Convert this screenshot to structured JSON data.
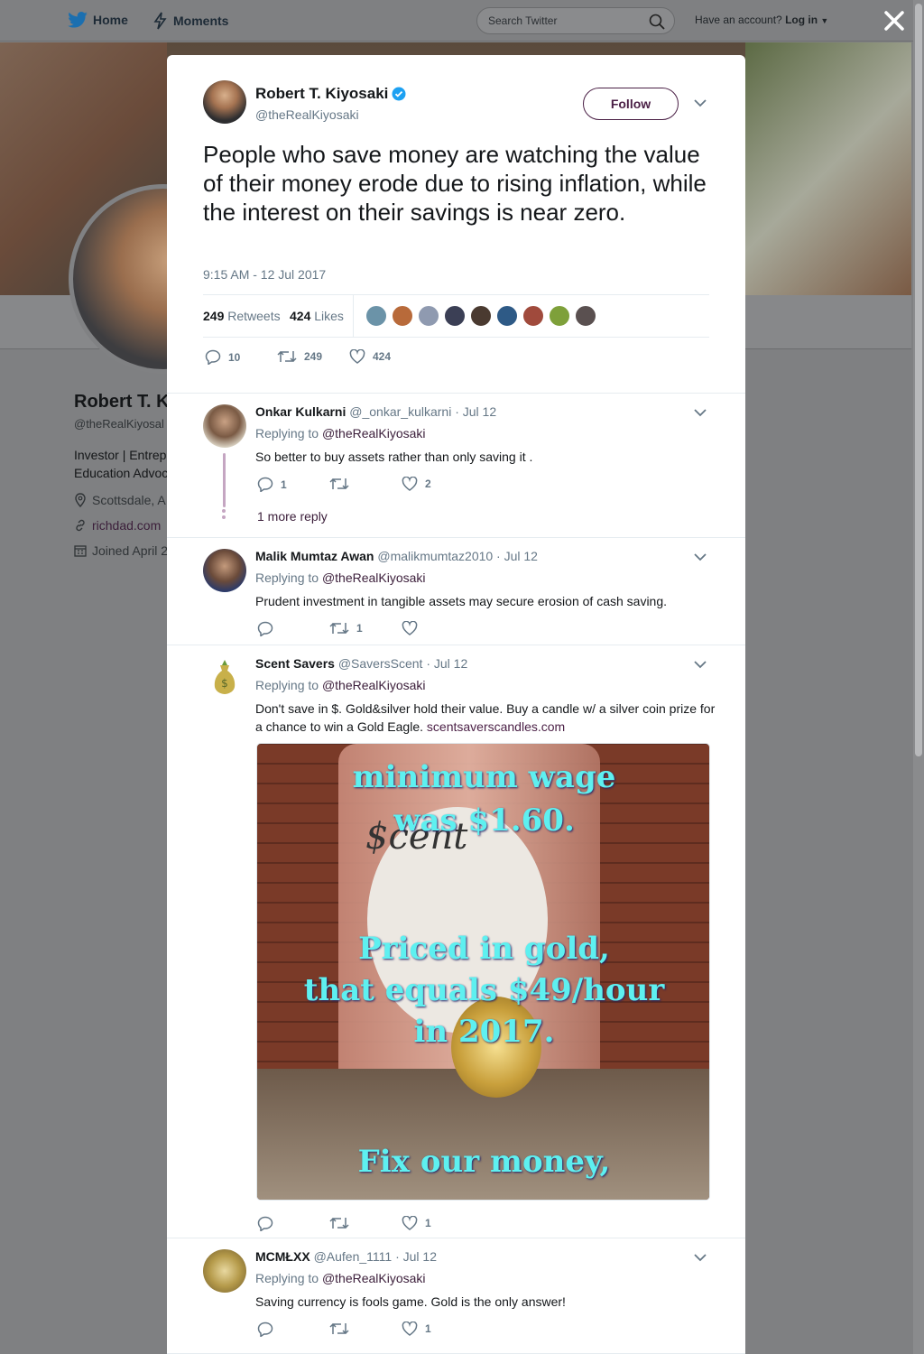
{
  "nav": {
    "home": "Home",
    "moments": "Moments",
    "search_placeholder": "Search Twitter",
    "have_account": "Have an account?",
    "login": "Log in"
  },
  "profile": {
    "name": "Robert T. K",
    "handle": "@theRealKiyosal",
    "bio": "Investor | Entrepr Education Advoc",
    "location": "Scottsdale, A",
    "website": "richdad.com",
    "joined": "Joined April 2"
  },
  "tweet": {
    "name": "Robert T. Kiyosaki",
    "handle": "@theRealKiyosaki",
    "follow_label": "Follow",
    "text": "People who save money are watching the value of their money erode due to rising inflation, while the interest on their savings is near zero.",
    "time": "9:15 AM - 12 Jul 2017",
    "retweets_count": "249",
    "retweets_label": "Retweets",
    "likes_count": "424",
    "likes_label": "Likes",
    "reply_count": "10",
    "retweet_count": "249",
    "like_count": "424"
  },
  "replies": [
    {
      "name": "Onkar Kulkarni",
      "meta": "@_onkar_kulkarni · Jul 12",
      "replying_prefix": "Replying to",
      "replying_to": "@theRealKiyosaki",
      "text": "So better to buy assets rather than only saving it .",
      "reply_count": "1",
      "retweet_count": "",
      "like_count": "2",
      "more": "1 more reply"
    },
    {
      "name": "Malik Mumtaz Awan",
      "meta": "@malikmumtaz2010 · Jul 12",
      "replying_prefix": "Replying to",
      "replying_to": "@theRealKiyosaki",
      "text": "Prudent investment in tangible assets may secure erosion of  cash saving.",
      "reply_count": "",
      "retweet_count": "1",
      "like_count": ""
    },
    {
      "name": "Scent Savers",
      "meta": "@SaversScent · Jul 12",
      "replying_prefix": "Replying to",
      "replying_to": "@theRealKiyosaki",
      "text": "Don't save in $. Gold&silver hold their value. Buy a candle w/ a silver coin prize for a chance to win a Gold Eagle.",
      "link": "scentsaverscandles.com",
      "reply_count": "",
      "retweet_count": "",
      "like_count": "1",
      "media": {
        "line1": "minimum wage",
        "line2": "was $1.60.",
        "line3": "Priced in gold,",
        "line4": "that equals $49/hour",
        "line5": "in 2017.",
        "line6": "Fix our money,",
        "label_text": "$cent"
      }
    },
    {
      "name": "MCMŁXX",
      "meta": "@Aufen_1111 · Jul 12",
      "replying_prefix": "Replying to",
      "replying_to": "@theRealKiyosaki",
      "text": "Saving currency is fools game. Gold is the only answer!",
      "reply_count": "",
      "retweet_count": "",
      "like_count": "1"
    }
  ],
  "colors": {
    "brand_purple": "#4a1f45",
    "link": "#3b1e3a",
    "muted": "#657786",
    "verified": "#1da1f2",
    "overlay": "#7f8082"
  }
}
